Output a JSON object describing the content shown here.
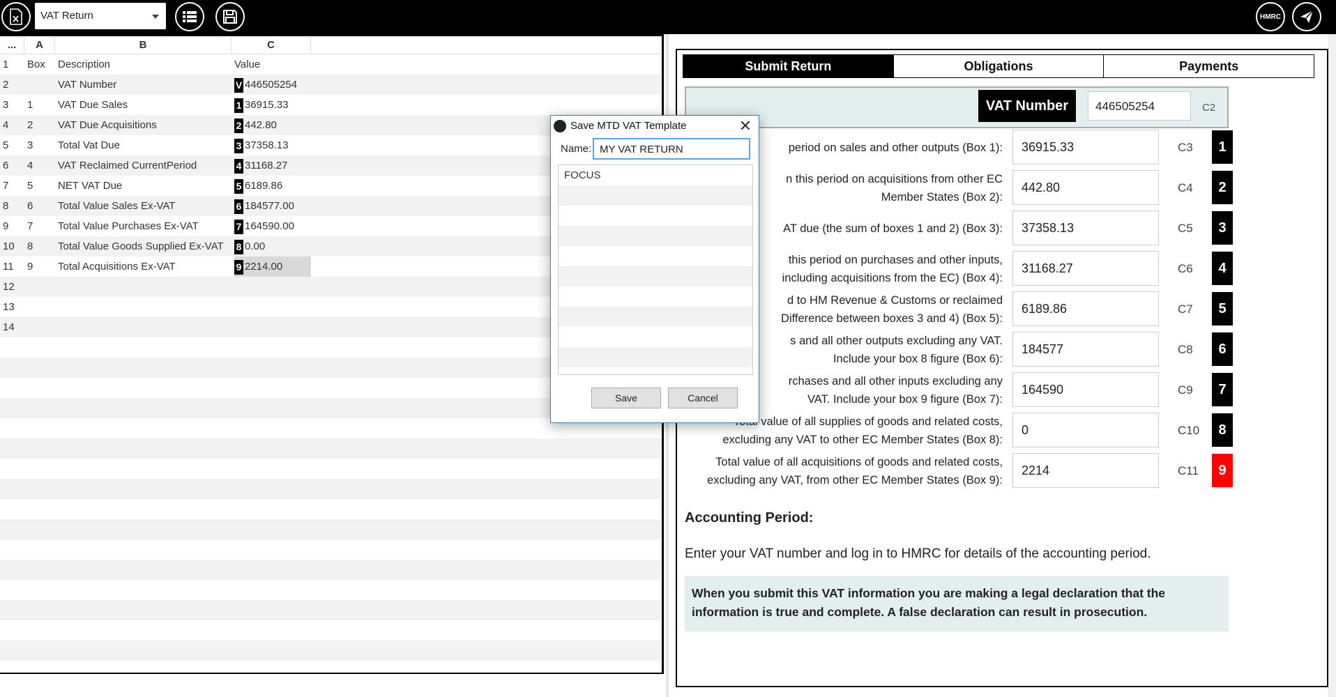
{
  "toolbar": {
    "template_value": "VAT Return",
    "hmrc_label": "HMRC"
  },
  "sheet": {
    "corner": "...",
    "col_a": "A",
    "col_b": "B",
    "col_c": "C",
    "rows": [
      {
        "n": "1",
        "a": "Box",
        "b": "Description",
        "c": "Value",
        "tag": ""
      },
      {
        "n": "2",
        "a": "",
        "b": "VAT Number",
        "c": "446505254",
        "tag": "V"
      },
      {
        "n": "3",
        "a": "1",
        "b": "VAT Due Sales",
        "c": "36915.33",
        "tag": "1"
      },
      {
        "n": "4",
        "a": "2",
        "b": "VAT Due Acquisitions",
        "c": "442.80",
        "tag": "2"
      },
      {
        "n": "5",
        "a": "3",
        "b": "Total Vat Due",
        "c": "37358.13",
        "tag": "3"
      },
      {
        "n": "6",
        "a": "4",
        "b": "VAT Reclaimed CurrentPeriod",
        "c": "31168.27",
        "tag": "4"
      },
      {
        "n": "7",
        "a": "5",
        "b": "NET VAT Due",
        "c": "6189.86",
        "tag": "5"
      },
      {
        "n": "8",
        "a": "6",
        "b": " Total Value Sales Ex-VAT",
        "c": "184577.00",
        "tag": "6"
      },
      {
        "n": "9",
        "a": "7",
        "b": "Total Value Purchases Ex-VAT",
        "c": "164590.00",
        "tag": "7"
      },
      {
        "n": "10",
        "a": "8",
        "b": "Total Value Goods Supplied Ex-VAT",
        "c": "0.00",
        "tag": "8"
      },
      {
        "n": "11",
        "a": "9",
        "b": "Total Acquisitions Ex-VAT",
        "c": "2214.00",
        "tag": "9"
      },
      {
        "n": "12",
        "a": "",
        "b": "",
        "c": "",
        "tag": ""
      },
      {
        "n": "13",
        "a": "",
        "b": "",
        "c": "",
        "tag": ""
      },
      {
        "n": "14",
        "a": "",
        "b": "",
        "c": "",
        "tag": ""
      }
    ]
  },
  "tabs": [
    "Submit Return",
    "Obligations",
    "Payments"
  ],
  "vat": {
    "label": "VAT Number",
    "value": "446505254",
    "ref": "C2"
  },
  "boxes": [
    {
      "line1": "",
      "line2": "period on sales and other outputs (Box 1):",
      "value": "36915.33",
      "ref": "C3",
      "num": "1"
    },
    {
      "line1": "n this period on acquisitions from other EC",
      "line2": "Member States (Box 2):",
      "value": "442.80",
      "ref": "C4",
      "num": "2"
    },
    {
      "line1": "",
      "line2": "AT due (the sum of boxes 1 and 2) (Box 3):",
      "value": "37358.13",
      "ref": "C5",
      "num": "3"
    },
    {
      "line1": "this period on purchases and other inputs,",
      "line2": "including acquisitions from the EC) (Box 4):",
      "value": "31168.27",
      "ref": "C6",
      "num": "4"
    },
    {
      "line1": "d to HM Revenue & Customs or reclaimed",
      "line2": "Difference between boxes 3 and 4) (Box 5):",
      "value": "6189.86",
      "ref": "C7",
      "num": "5"
    },
    {
      "line1": "s and all other outputs excluding any VAT.",
      "line2": "Include your box 8 figure (Box 6):",
      "value": "184577",
      "ref": "C8",
      "num": "6"
    },
    {
      "line1": "rchases and all other inputs excluding any",
      "line2": "VAT. Include your box 9 figure (Box 7):",
      "value": "164590",
      "ref": "C9",
      "num": "7"
    },
    {
      "line1": "Total value of all supplies of goods and related costs,",
      "line2": "excluding any VAT to other EC Member States (Box 8):",
      "value": "0",
      "ref": "C10",
      "num": "8"
    },
    {
      "line1": "Total value of all acquisitions of goods and related costs,",
      "line2": "excluding any VAT, from other EC Member States (Box 9):",
      "value": "2214",
      "ref": "C11",
      "num": "9"
    }
  ],
  "accounting": {
    "title": "Accounting Period:",
    "text": "Enter your VAT number and log in to HMRC for details of the accounting period."
  },
  "declaration": {
    "line1": "When you submit this VAT information you are making a legal declaration that the",
    "line2": "information is true and complete. A false declaration can result in prosecution."
  },
  "dialog": {
    "title": "Save MTD VAT Template",
    "close": "✕",
    "name_label": "Name:",
    "name_value": "MY VAT RETURN",
    "items": [
      "FOCUS",
      "",
      "",
      "",
      "",
      "",
      "",
      "",
      "",
      ""
    ],
    "save": "Save",
    "cancel": "Cancel"
  },
  "colors": {
    "accent_black": "#000000",
    "highlight_red": "#ff0000",
    "panel_teal": "#e3eeee"
  }
}
